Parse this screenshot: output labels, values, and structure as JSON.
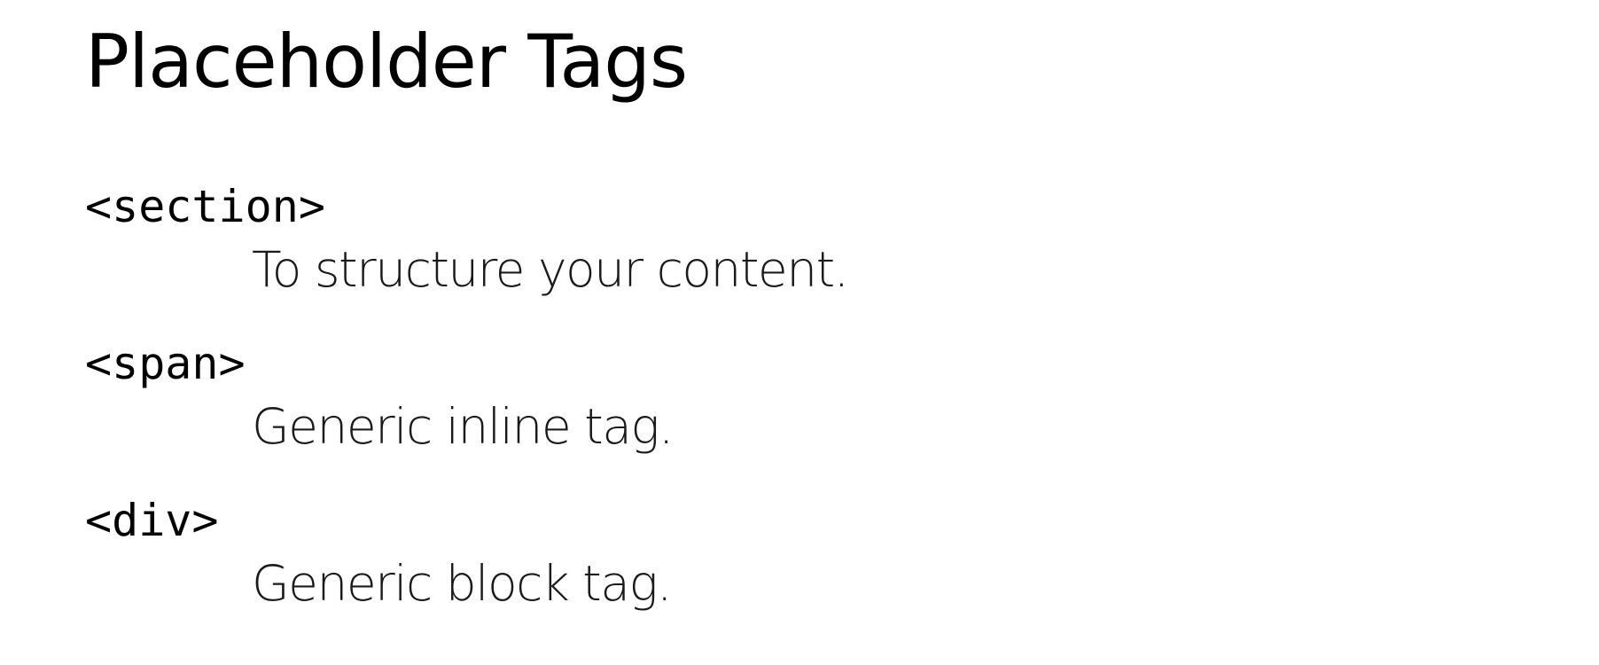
{
  "slide": {
    "title": "Placeholder Tags",
    "items": [
      {
        "term": "<section>",
        "definition": "To structure your content."
      },
      {
        "term": "<span>",
        "definition": "Generic inline tag."
      },
      {
        "term": "<div>",
        "definition": "Generic block tag."
      }
    ]
  }
}
